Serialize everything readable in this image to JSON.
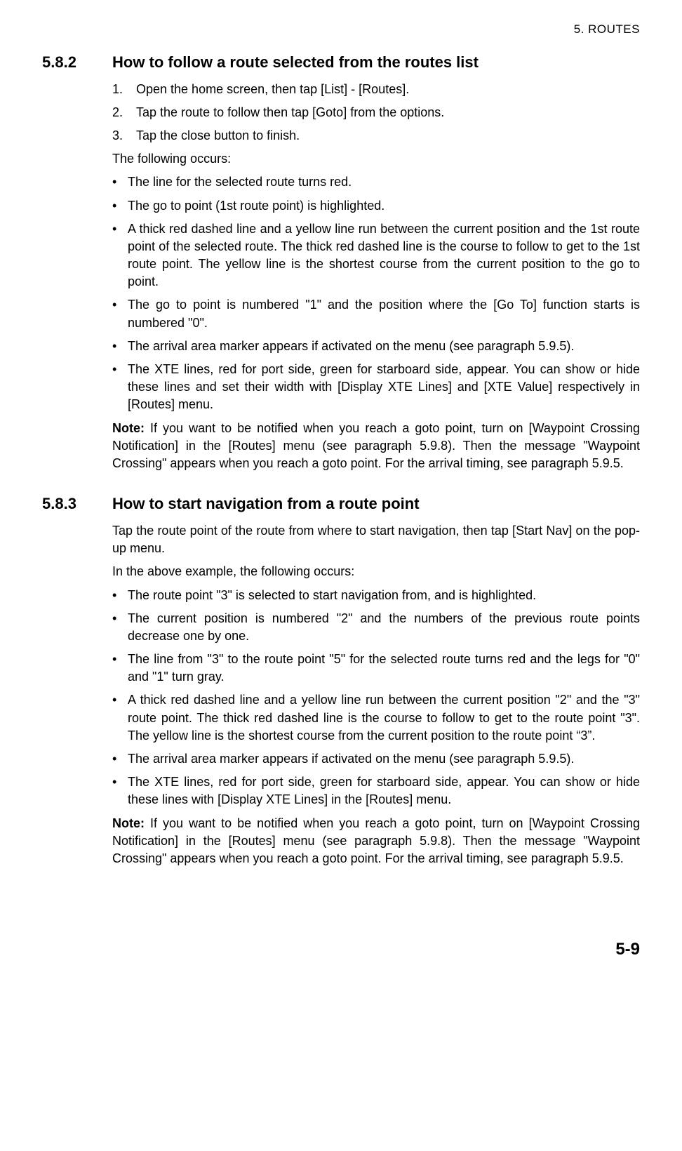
{
  "header": {
    "chapter": "5.  ROUTES"
  },
  "sections": [
    {
      "number": "5.8.2",
      "title": "How to follow a route selected from the routes list",
      "ordered": [
        "Open the home screen, then tap [List] - [Routes].",
        "Tap the route to follow then tap [Goto] from the options.",
        "Tap the close button to finish."
      ],
      "intro": "The following occurs:",
      "bullets": [
        "The line for the selected route turns red.",
        "The go to point (1st route point) is highlighted.",
        " A thick red dashed line and a yellow line run between the current position and the 1st route point of the selected route. The thick red dashed line is the course to follow to get to the 1st route point. The yellow line is the shortest course from the current position to the go to point.",
        "The go to point is numbered \"1\" and the position where the [Go To] function starts is numbered \"0\".",
        "The arrival area marker appears if activated on the menu (see paragraph 5.9.5).",
        "The XTE lines, red for port side, green for starboard side, appear. You can show or hide these lines and set their width with [Display XTE Lines] and [XTE Value] respectively in [Routes] menu."
      ],
      "note_label": "Note:",
      "note": " If you want to be notified when you reach a goto point, turn on [Waypoint Crossing Notification] in the [Routes] menu (see paragraph 5.9.8). Then the message \"Waypoint Crossing\" appears when you reach a goto point. For the arrival timing, see paragraph 5.9.5."
    },
    {
      "number": "5.8.3",
      "title": "How to start navigation from a route point",
      "lead": "Tap the route point of the route from where to start navigation, then tap [Start Nav] on the pop-up menu.",
      "intro": "In the above example, the following occurs:",
      "bullets": [
        "The route point \"3\" is selected to start navigation from, and is highlighted.",
        "The current position is numbered \"2\" and the numbers of the previous route points decrease one by one.",
        "The line from \"3\" to the route point \"5\" for the selected route turns red and the legs for \"0\" and \"1\" turn gray.",
        "A thick red dashed line and a yellow line run between the current position \"2\" and the \"3\" route point. The thick red dashed line is the course to follow to get to the route point \"3\". The yellow line is the shortest course from the current position to the route point “3”.",
        "The arrival area marker appears if activated on the menu (see paragraph 5.9.5).",
        "The XTE lines, red for port side, green for starboard side, appear. You can show or hide these lines with [Display XTE Lines] in the [Routes] menu."
      ],
      "note_label": "Note:",
      "note": " If you want to be notified when you reach a goto point, turn on [Waypoint Crossing Notification] in the [Routes] menu (see paragraph 5.9.8). Then the message \"Waypoint Crossing\" appears when you reach a goto point. For the arrival timing, see paragraph 5.9.5."
    }
  ],
  "footer": {
    "page": "5-9"
  }
}
